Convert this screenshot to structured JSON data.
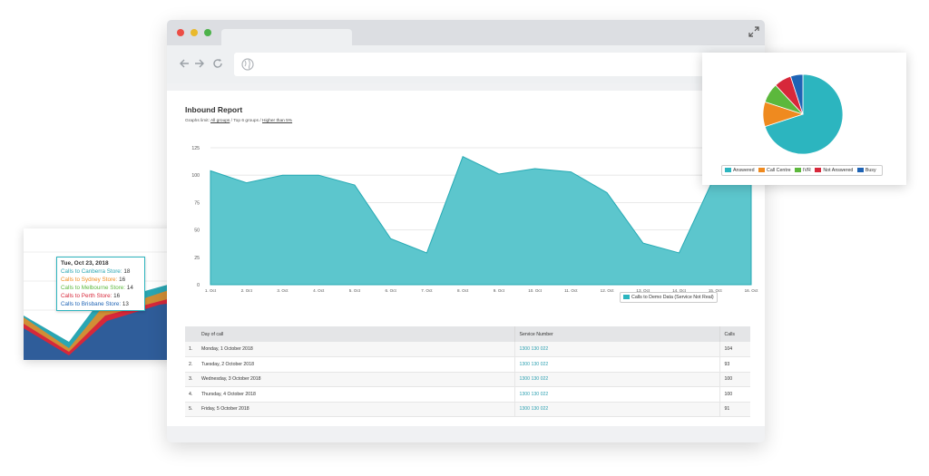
{
  "tooltip": {
    "title": "Tue, Oct 23, 2018",
    "rows": [
      {
        "label": "Calls to Canberra Store:",
        "value": "18",
        "color": "#2aa6b3"
      },
      {
        "label": "Calls to Sydney Store:",
        "value": "16",
        "color": "#ef8a1f"
      },
      {
        "label": "Calls to Melbourne Store:",
        "value": "14",
        "color": "#5cb83c"
      },
      {
        "label": "Calls to Perth Store:",
        "value": "16",
        "color": "#d7283a"
      },
      {
        "label": "Calls to Brisbane Store:",
        "value": "13",
        "color": "#1e63b4"
      }
    ]
  },
  "browser": {
    "icons": [
      "back-icon",
      "forward-icon",
      "reload-icon",
      "globe-icon",
      "expand-icon"
    ]
  },
  "report": {
    "title": "Inbound Report",
    "graph_limit_prefix": "Graphs limit:",
    "link_all_groups": "All groups",
    "separator1": " / Top 6 groups / ",
    "link_higher": "Higher than 5%"
  },
  "chart_data": {
    "type": "area",
    "categories": [
      "1. Oct",
      "2. Oct",
      "3. Oct",
      "4. Oct",
      "5. Oct",
      "6. Oct",
      "7. Oct",
      "8. Oct",
      "9. Oct",
      "10. Oct",
      "11. Oct",
      "12. Oct",
      "13. Oct",
      "14. Oct",
      "15. Oct",
      "16. Oct"
    ],
    "series": [
      {
        "name": "Calls to Demo Data (Service Not Real)",
        "values": [
          104,
          93,
          100,
          100,
          91,
          42,
          29,
          117,
          101,
          106,
          103,
          84,
          38,
          29,
          100,
          104
        ]
      }
    ],
    "yticks": [
      0,
      25,
      50,
      75,
      100,
      125
    ],
    "ylim": [
      0,
      125
    ],
    "grid": true,
    "legend_position": "bottom-right",
    "color": "#2cb5bf"
  },
  "table": {
    "headers": [
      "Day of call",
      "Service Number",
      "Calls"
    ],
    "rows": [
      {
        "n": "1.",
        "day": "Monday, 1 October 2018",
        "service": "1300 130 022",
        "calls": "104"
      },
      {
        "n": "2.",
        "day": "Tuesday, 2 October 2018",
        "service": "1300 130 022",
        "calls": "93"
      },
      {
        "n": "3.",
        "day": "Wednesday, 3 October 2018",
        "service": "1300 130 022",
        "calls": "100"
      },
      {
        "n": "4.",
        "day": "Thursday, 4 October 2018",
        "service": "1300 130 022",
        "calls": "100"
      },
      {
        "n": "5.",
        "day": "Friday, 5 October 2018",
        "service": "1300 130 022",
        "calls": "91"
      }
    ]
  },
  "pie": {
    "slices": [
      {
        "name": "Answered",
        "value": 70,
        "color": "#2cb5bf"
      },
      {
        "name": "Call Centre",
        "value": 10,
        "color": "#ef8a1f"
      },
      {
        "name": "IVR",
        "value": 8,
        "color": "#5cb83c"
      },
      {
        "name": "Not Answered",
        "value": 7,
        "color": "#d7283a"
      },
      {
        "name": "Busy",
        "value": 5,
        "color": "#1e63b4"
      }
    ]
  }
}
